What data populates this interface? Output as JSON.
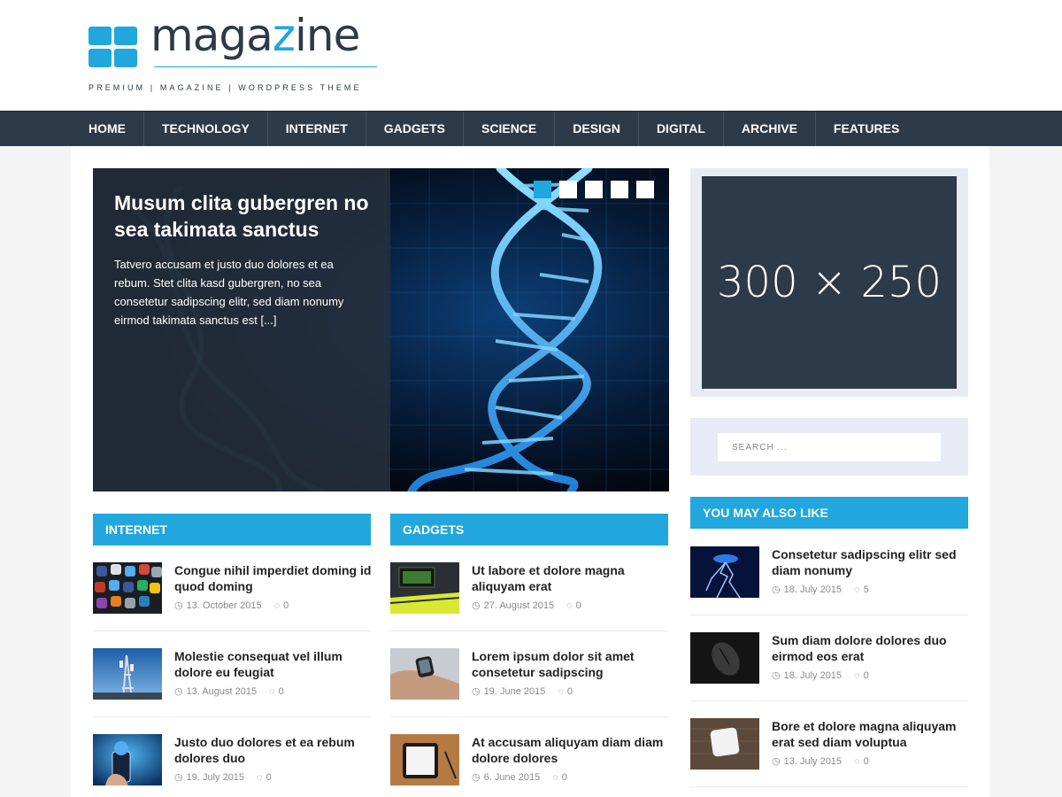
{
  "header": {
    "logo_text": "magazine",
    "tagline": "PREMIUM | MAGAZINE | WORDPRESS THEME"
  },
  "nav": {
    "items": [
      "HOME",
      "TECHNOLOGY",
      "INTERNET",
      "GADGETS",
      "SCIENCE",
      "DESIGN",
      "DIGITAL",
      "ARCHIVE",
      "FEATURES"
    ]
  },
  "slider": {
    "title": "Musum clita gubergren no sea takimata sanctus",
    "excerpt": "Tatvero accusam et justo duo dolores et ea rebum. Stet clita kasd gubergren, no sea consetetur sadipscing elitr, sed diam nonumy eirmod takimata sanctus est [...]",
    "dots": 5,
    "active_dot": 0
  },
  "internet": {
    "heading": "INTERNET",
    "posts": [
      {
        "title": "Congue nihil imperdiet doming id quod doming",
        "date": "13. October 2015",
        "comments": "0"
      },
      {
        "title": "Molestie consequat vel illum dolore eu feugiat",
        "date": "13. August 2015",
        "comments": "0"
      },
      {
        "title": "Justo duo dolores et ea rebum dolores duo",
        "date": "19. July 2015",
        "comments": "0"
      }
    ]
  },
  "gadgets": {
    "heading": "GADGETS",
    "posts": [
      {
        "title": "Ut labore et dolore magna aliquyam erat",
        "date": "27. August 2015",
        "comments": "0"
      },
      {
        "title": "Lorem ipsum dolor sit amet consetetur sadipscing",
        "date": "19. June 2015",
        "comments": "0"
      },
      {
        "title": "At accusam aliquyam diam diam dolore dolores",
        "date": "6. June 2015",
        "comments": "0"
      }
    ]
  },
  "sidebar": {
    "ad_text": "300 × 250",
    "search_placeholder": "SEARCH ...",
    "also_like": {
      "heading": "YOU MAY ALSO LIKE",
      "posts": [
        {
          "title": "Consetetur sadipscing elitr sed diam nonumy",
          "date": "18. July 2015",
          "comments": "5"
        },
        {
          "title": "Sum diam dolore dolores duo eirmod eos erat",
          "date": "18. July 2015",
          "comments": "0"
        },
        {
          "title": "Bore et dolore magna aliquyam erat sed diam voluptua",
          "date": "13. July 2015",
          "comments": "0"
        }
      ]
    }
  },
  "colors": {
    "accent": "#21a7dd",
    "dark": "#2d3a47"
  },
  "icons": {
    "date": "clock-icon",
    "comments": "comment-icon"
  }
}
